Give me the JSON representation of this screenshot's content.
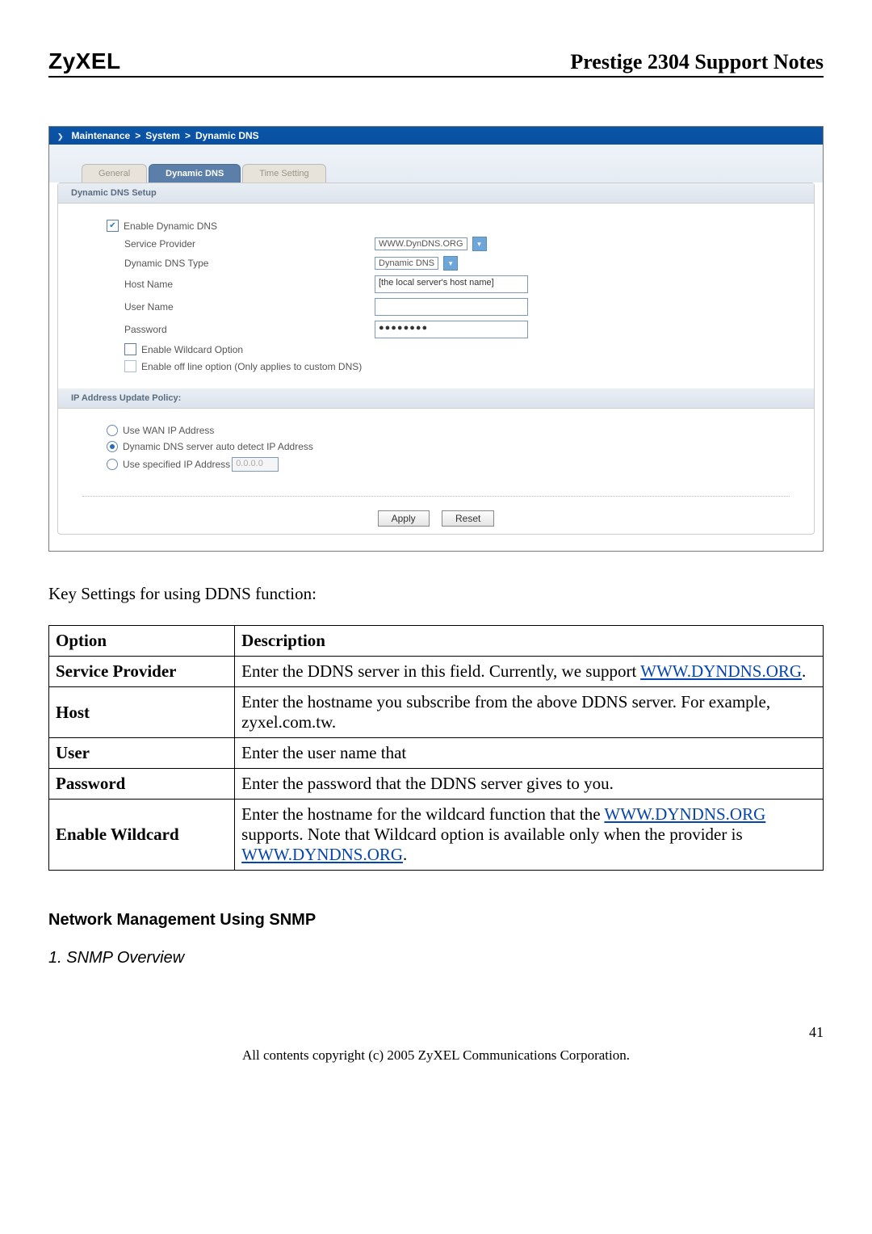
{
  "header": {
    "logo": "ZyXEL",
    "title": "Prestige 2304 Support Notes"
  },
  "router": {
    "breadcrumb": [
      "Maintenance",
      "System",
      "Dynamic DNS"
    ],
    "tabs": [
      "General",
      "Dynamic DNS",
      "Time Setting"
    ],
    "section1_title": "Dynamic DNS Setup",
    "enable_label": "Enable Dynamic DNS",
    "rows": {
      "service_provider": "Service Provider",
      "service_provider_val": "WWW.DynDNS.ORG",
      "dns_type": "Dynamic DNS Type",
      "dns_type_val": "Dynamic DNS",
      "host": "Host Name",
      "host_val": "[the local server's host name]",
      "user": "User Name",
      "password": "Password",
      "password_val": "●●●●●●●●",
      "wildcard": "Enable Wildcard Option",
      "offline": "Enable off line option (Only applies to custom DNS)"
    },
    "section2_title": "IP Address Update Policy:",
    "policy": {
      "wan": "Use WAN IP Address",
      "auto": "Dynamic DNS server auto detect IP Address",
      "spec": "Use specified IP Address",
      "spec_ip": "0.0.0.0"
    },
    "buttons": {
      "apply": "Apply",
      "reset": "Reset"
    }
  },
  "body": {
    "intro": "Key Settings for using DDNS function:",
    "table_headers": [
      "Option",
      "Description"
    ],
    "table": [
      {
        "opt": "Service Provider",
        "desc_prefix": "Enter the DDNS server in this field. Currently, we support ",
        "link": "WWW.DYNDNS.ORG",
        "desc_suffix": "."
      },
      {
        "opt": "Host",
        "desc": "Enter the hostname you subscribe from the above DDNS server. For example, zyxel.com.tw."
      },
      {
        "opt": "User",
        "desc": "Enter the user name that"
      },
      {
        "opt": "Password",
        "desc": "Enter the password that the DDNS server gives to you."
      },
      {
        "opt": "Enable Wildcard",
        "desc_prefix": "Enter the hostname for the wildcard function that the ",
        "link1": "WWW.DYNDNS.ORG",
        "mid": " supports. Note that Wildcard option is available only when the provider is ",
        "link2": "WWW.DYNDNS.ORG",
        "suffix": "."
      }
    ],
    "h3": "Network Management Using SNMP",
    "h4": "1. SNMP Overview",
    "page": "41",
    "footer": "All contents copyright (c) 2005 ZyXEL Communications Corporation."
  }
}
